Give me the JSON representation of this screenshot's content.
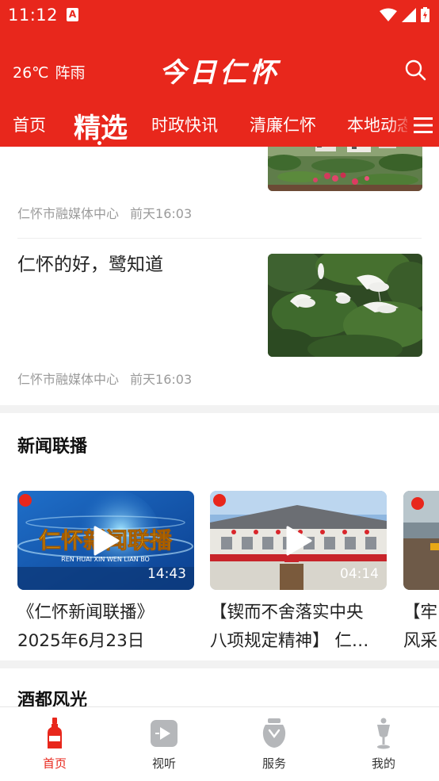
{
  "status": {
    "time": "11:12",
    "app_icon_letter": "A"
  },
  "header": {
    "weather_temp": "26℃",
    "weather_desc": "阵雨",
    "app_title": "今日仁怀"
  },
  "tabs": [
    {
      "label": "首页"
    },
    {
      "label": "精选"
    },
    {
      "label": "时政快讯"
    },
    {
      "label": "清廉仁怀"
    },
    {
      "label": "本地动态"
    }
  ],
  "articles": [
    {
      "source": "仁怀市融媒体中心",
      "time": "前天16:03"
    },
    {
      "title": "仁怀的好，鹭知道",
      "source": "仁怀市融媒体中心",
      "time": "前天16:03"
    }
  ],
  "news_section": {
    "title": "新闻联播",
    "videos": [
      {
        "thumb_text": "仁怀新闻联播",
        "thumb_subtext": "REN HUAI XIN WEN LIAN BO",
        "duration": "14:43",
        "caption_line1": "《仁怀新闻联播》",
        "caption_line2": "2025年6月23日"
      },
      {
        "duration": "04:14",
        "caption_line1": "【锲而不舍落实中央",
        "caption_line2": "八项规定精神】 仁…"
      },
      {
        "caption_line1": "【牢",
        "caption_line2": "风采"
      }
    ]
  },
  "scenery_section": {
    "title": "酒都风光"
  },
  "bottom_nav": [
    {
      "label": "首页",
      "icon": "liquor-bottle-icon",
      "active": true
    },
    {
      "label": "视听",
      "icon": "video-play-icon",
      "active": false
    },
    {
      "label": "服务",
      "icon": "wine-jar-icon",
      "active": false
    },
    {
      "label": "我的",
      "icon": "goblet-icon",
      "active": false
    }
  ],
  "colors": {
    "brand_red": "#e8271c",
    "meta_gray": "#9a9a9a",
    "divider": "#eeeeee"
  }
}
